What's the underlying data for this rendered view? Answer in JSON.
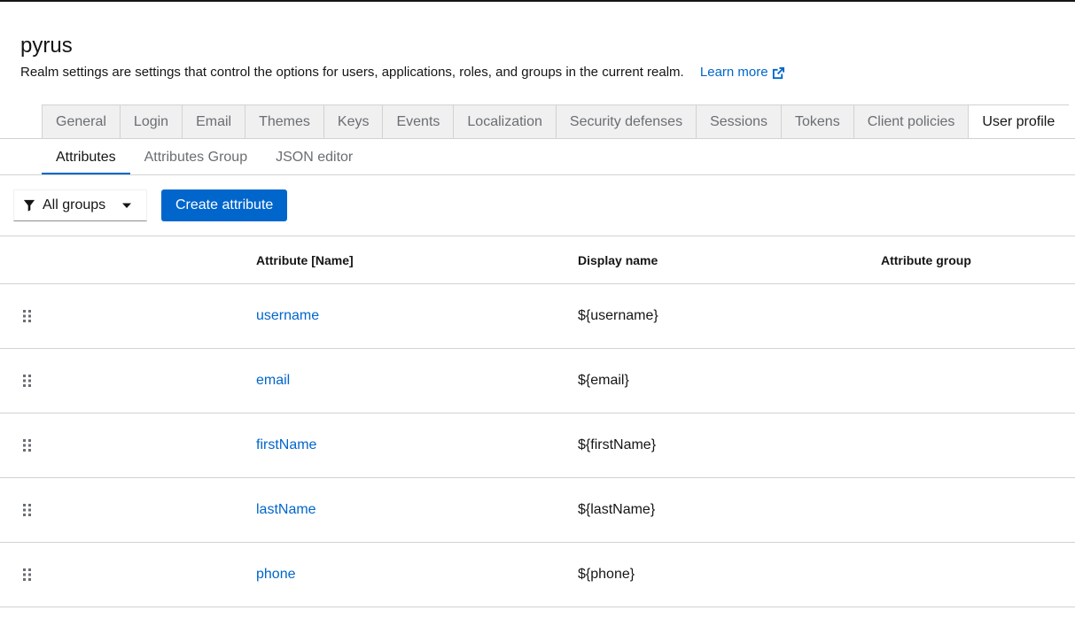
{
  "realm": {
    "title": "pyrus",
    "description": "Realm settings are settings that control the options for users, applications, roles, and groups in the current realm.",
    "learn_more": "Learn more"
  },
  "tabs": [
    {
      "label": "General"
    },
    {
      "label": "Login"
    },
    {
      "label": "Email"
    },
    {
      "label": "Themes"
    },
    {
      "label": "Keys"
    },
    {
      "label": "Events"
    },
    {
      "label": "Localization"
    },
    {
      "label": "Security defenses"
    },
    {
      "label": "Sessions"
    },
    {
      "label": "Tokens"
    },
    {
      "label": "Client policies"
    },
    {
      "label": "User profile",
      "active": true
    }
  ],
  "subtabs": [
    {
      "label": "Attributes",
      "active": true
    },
    {
      "label": "Attributes Group"
    },
    {
      "label": "JSON editor"
    }
  ],
  "toolbar": {
    "filter_label": "All groups",
    "create_label": "Create attribute"
  },
  "table": {
    "headers": [
      "Attribute [Name]",
      "Display name",
      "Attribute group"
    ],
    "rows": [
      {
        "name": "username",
        "display": "${username}",
        "group": ""
      },
      {
        "name": "email",
        "display": "${email}",
        "group": ""
      },
      {
        "name": "firstName",
        "display": "${firstName}",
        "group": ""
      },
      {
        "name": "lastName",
        "display": "${lastName}",
        "group": ""
      },
      {
        "name": "phone",
        "display": "${phone}",
        "group": ""
      }
    ]
  },
  "colors": {
    "accent": "#0066cc",
    "text": "#151515",
    "muted": "#6a6e73",
    "border": "#d2d2d2",
    "tab_bg": "#f0f0f0"
  },
  "icons": {
    "external_link": "external-link-icon",
    "filter": "filter-icon",
    "caret": "caret-down-icon",
    "drag": "drag-handle-icon"
  }
}
